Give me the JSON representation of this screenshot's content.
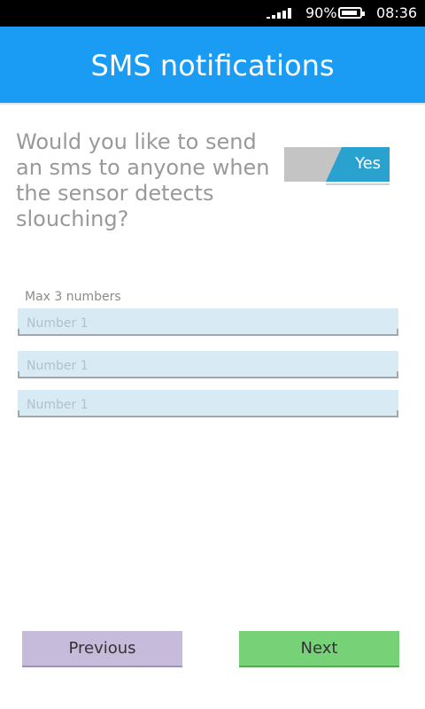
{
  "status_bar": {
    "battery_percent": "90%",
    "time": "08:36",
    "signal_icon": "signal-bars-icon",
    "battery_icon": "battery-icon"
  },
  "header": {
    "title": "SMS notifications"
  },
  "question": {
    "text": "Would you like to send an sms to anyone when the sensor detects slouching?"
  },
  "toggle": {
    "label": "Yes",
    "state": "on"
  },
  "numbers": {
    "hint": "Max 3 numbers",
    "fields": [
      {
        "placeholder": "Number 1",
        "value": ""
      },
      {
        "placeholder": "Number 1",
        "value": ""
      },
      {
        "placeholder": "Number 1",
        "value": ""
      }
    ]
  },
  "buttons": {
    "previous": "Previous",
    "next": "Next"
  },
  "colors": {
    "header": "#1a9cf4",
    "toggle_on": "#2aa2cf",
    "previous_button": "#c7bbdb",
    "next_button": "#77d177",
    "input_background": "#d8eaf3"
  }
}
